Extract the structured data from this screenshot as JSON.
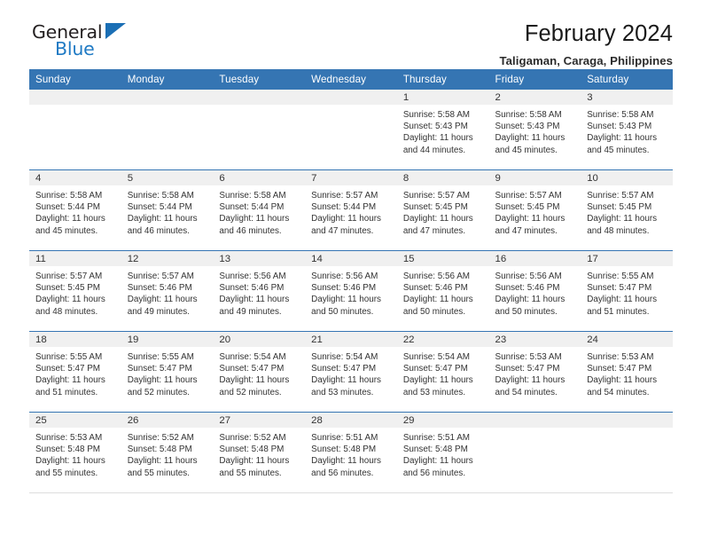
{
  "logo": {
    "word_top": "General",
    "word_bottom": "Blue",
    "triangle_icon": "triangle-icon"
  },
  "header": {
    "title": "February 2024",
    "subtitle": "Taligaman, Caraga, Philippines"
  },
  "colors": {
    "header_blue": "#3575b3",
    "daynum_band": "#f0f0f0",
    "logo_blue": "#1f7ac4",
    "text": "#333333"
  },
  "weekday_headers": [
    "Sunday",
    "Monday",
    "Tuesday",
    "Wednesday",
    "Thursday",
    "Friday",
    "Saturday"
  ],
  "labels": {
    "sunrise_prefix": "Sunrise: ",
    "sunset_prefix": "Sunset: ",
    "daylight_prefix": "Daylight: "
  },
  "weeks": [
    [
      {
        "day": "",
        "sunrise": "",
        "sunset": "",
        "daylight": ""
      },
      {
        "day": "",
        "sunrise": "",
        "sunset": "",
        "daylight": ""
      },
      {
        "day": "",
        "sunrise": "",
        "sunset": "",
        "daylight": ""
      },
      {
        "day": "",
        "sunrise": "",
        "sunset": "",
        "daylight": ""
      },
      {
        "day": "1",
        "sunrise": "Sunrise: 5:58 AM",
        "sunset": "Sunset: 5:43 PM",
        "daylight": "Daylight: 11 hours and 44 minutes."
      },
      {
        "day": "2",
        "sunrise": "Sunrise: 5:58 AM",
        "sunset": "Sunset: 5:43 PM",
        "daylight": "Daylight: 11 hours and 45 minutes."
      },
      {
        "day": "3",
        "sunrise": "Sunrise: 5:58 AM",
        "sunset": "Sunset: 5:43 PM",
        "daylight": "Daylight: 11 hours and 45 minutes."
      }
    ],
    [
      {
        "day": "4",
        "sunrise": "Sunrise: 5:58 AM",
        "sunset": "Sunset: 5:44 PM",
        "daylight": "Daylight: 11 hours and 45 minutes."
      },
      {
        "day": "5",
        "sunrise": "Sunrise: 5:58 AM",
        "sunset": "Sunset: 5:44 PM",
        "daylight": "Daylight: 11 hours and 46 minutes."
      },
      {
        "day": "6",
        "sunrise": "Sunrise: 5:58 AM",
        "sunset": "Sunset: 5:44 PM",
        "daylight": "Daylight: 11 hours and 46 minutes."
      },
      {
        "day": "7",
        "sunrise": "Sunrise: 5:57 AM",
        "sunset": "Sunset: 5:44 PM",
        "daylight": "Daylight: 11 hours and 47 minutes."
      },
      {
        "day": "8",
        "sunrise": "Sunrise: 5:57 AM",
        "sunset": "Sunset: 5:45 PM",
        "daylight": "Daylight: 11 hours and 47 minutes."
      },
      {
        "day": "9",
        "sunrise": "Sunrise: 5:57 AM",
        "sunset": "Sunset: 5:45 PM",
        "daylight": "Daylight: 11 hours and 47 minutes."
      },
      {
        "day": "10",
        "sunrise": "Sunrise: 5:57 AM",
        "sunset": "Sunset: 5:45 PM",
        "daylight": "Daylight: 11 hours and 48 minutes."
      }
    ],
    [
      {
        "day": "11",
        "sunrise": "Sunrise: 5:57 AM",
        "sunset": "Sunset: 5:45 PM",
        "daylight": "Daylight: 11 hours and 48 minutes."
      },
      {
        "day": "12",
        "sunrise": "Sunrise: 5:57 AM",
        "sunset": "Sunset: 5:46 PM",
        "daylight": "Daylight: 11 hours and 49 minutes."
      },
      {
        "day": "13",
        "sunrise": "Sunrise: 5:56 AM",
        "sunset": "Sunset: 5:46 PM",
        "daylight": "Daylight: 11 hours and 49 minutes."
      },
      {
        "day": "14",
        "sunrise": "Sunrise: 5:56 AM",
        "sunset": "Sunset: 5:46 PM",
        "daylight": "Daylight: 11 hours and 50 minutes."
      },
      {
        "day": "15",
        "sunrise": "Sunrise: 5:56 AM",
        "sunset": "Sunset: 5:46 PM",
        "daylight": "Daylight: 11 hours and 50 minutes."
      },
      {
        "day": "16",
        "sunrise": "Sunrise: 5:56 AM",
        "sunset": "Sunset: 5:46 PM",
        "daylight": "Daylight: 11 hours and 50 minutes."
      },
      {
        "day": "17",
        "sunrise": "Sunrise: 5:55 AM",
        "sunset": "Sunset: 5:47 PM",
        "daylight": "Daylight: 11 hours and 51 minutes."
      }
    ],
    [
      {
        "day": "18",
        "sunrise": "Sunrise: 5:55 AM",
        "sunset": "Sunset: 5:47 PM",
        "daylight": "Daylight: 11 hours and 51 minutes."
      },
      {
        "day": "19",
        "sunrise": "Sunrise: 5:55 AM",
        "sunset": "Sunset: 5:47 PM",
        "daylight": "Daylight: 11 hours and 52 minutes."
      },
      {
        "day": "20",
        "sunrise": "Sunrise: 5:54 AM",
        "sunset": "Sunset: 5:47 PM",
        "daylight": "Daylight: 11 hours and 52 minutes."
      },
      {
        "day": "21",
        "sunrise": "Sunrise: 5:54 AM",
        "sunset": "Sunset: 5:47 PM",
        "daylight": "Daylight: 11 hours and 53 minutes."
      },
      {
        "day": "22",
        "sunrise": "Sunrise: 5:54 AM",
        "sunset": "Sunset: 5:47 PM",
        "daylight": "Daylight: 11 hours and 53 minutes."
      },
      {
        "day": "23",
        "sunrise": "Sunrise: 5:53 AM",
        "sunset": "Sunset: 5:47 PM",
        "daylight": "Daylight: 11 hours and 54 minutes."
      },
      {
        "day": "24",
        "sunrise": "Sunrise: 5:53 AM",
        "sunset": "Sunset: 5:47 PM",
        "daylight": "Daylight: 11 hours and 54 minutes."
      }
    ],
    [
      {
        "day": "25",
        "sunrise": "Sunrise: 5:53 AM",
        "sunset": "Sunset: 5:48 PM",
        "daylight": "Daylight: 11 hours and 55 minutes."
      },
      {
        "day": "26",
        "sunrise": "Sunrise: 5:52 AM",
        "sunset": "Sunset: 5:48 PM",
        "daylight": "Daylight: 11 hours and 55 minutes."
      },
      {
        "day": "27",
        "sunrise": "Sunrise: 5:52 AM",
        "sunset": "Sunset: 5:48 PM",
        "daylight": "Daylight: 11 hours and 55 minutes."
      },
      {
        "day": "28",
        "sunrise": "Sunrise: 5:51 AM",
        "sunset": "Sunset: 5:48 PM",
        "daylight": "Daylight: 11 hours and 56 minutes."
      },
      {
        "day": "29",
        "sunrise": "Sunrise: 5:51 AM",
        "sunset": "Sunset: 5:48 PM",
        "daylight": "Daylight: 11 hours and 56 minutes."
      },
      {
        "day": "",
        "sunrise": "",
        "sunset": "",
        "daylight": ""
      },
      {
        "day": "",
        "sunrise": "",
        "sunset": "",
        "daylight": ""
      }
    ]
  ]
}
